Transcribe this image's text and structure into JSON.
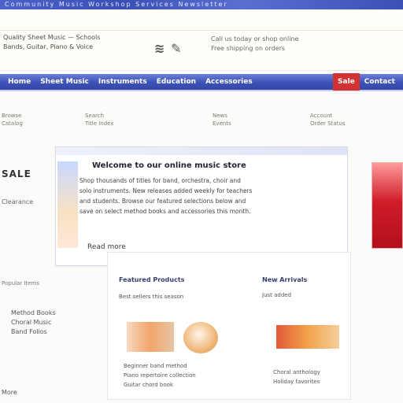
{
  "top_strip": {
    "text": "Community Music Workshop Services Newsletter"
  },
  "masthead": {
    "left_lines": [
      "Quality Sheet Music — Schools",
      "Bands, Guitar, Piano & Voice"
    ],
    "center_text": "≋ ✎",
    "right_lines": [
      "Call us today or shop online",
      "Free shipping on orders"
    ]
  },
  "nav": {
    "items": [
      {
        "label": "Home"
      },
      {
        "label": "Sheet Music"
      },
      {
        "label": "Instruments"
      },
      {
        "label": "Education"
      },
      {
        "label": "Accessories"
      },
      {
        "label": "Sale"
      },
      {
        "label": "Contact"
      }
    ]
  },
  "subrow": {
    "cols": [
      [
        "Browse",
        "Catalog"
      ],
      [
        "Search",
        "Title Index"
      ],
      [
        "News",
        "Events"
      ],
      [
        "Account",
        "Order Status"
      ]
    ]
  },
  "rail": {
    "title": "SALE",
    "subtitle": "Clearance",
    "note": "Popular Items",
    "list": [
      "Method Books",
      "Choral Music",
      "Band Folios"
    ],
    "foot": "More"
  },
  "card": {
    "title": "Welcome to our online music store",
    "body_lines": [
      "Shop thousands of titles for band, orchestra, choir and",
      "solo instruments. New releases added weekly for teachers",
      "and students. Browse our featured selections below and",
      "save on select method books and accessories this month."
    ],
    "link": "Read more"
  },
  "feature": {
    "head_left": "Featured Products",
    "sub_left": "Best sellers this season",
    "head_right": "New Arrivals",
    "sub_right": "Just added",
    "text_left": [
      "Beginner band method",
      "Piano repertoire collection",
      "Guitar chord book"
    ],
    "text_right": [
      "Choral anthology",
      "Holiday favorites"
    ]
  }
}
